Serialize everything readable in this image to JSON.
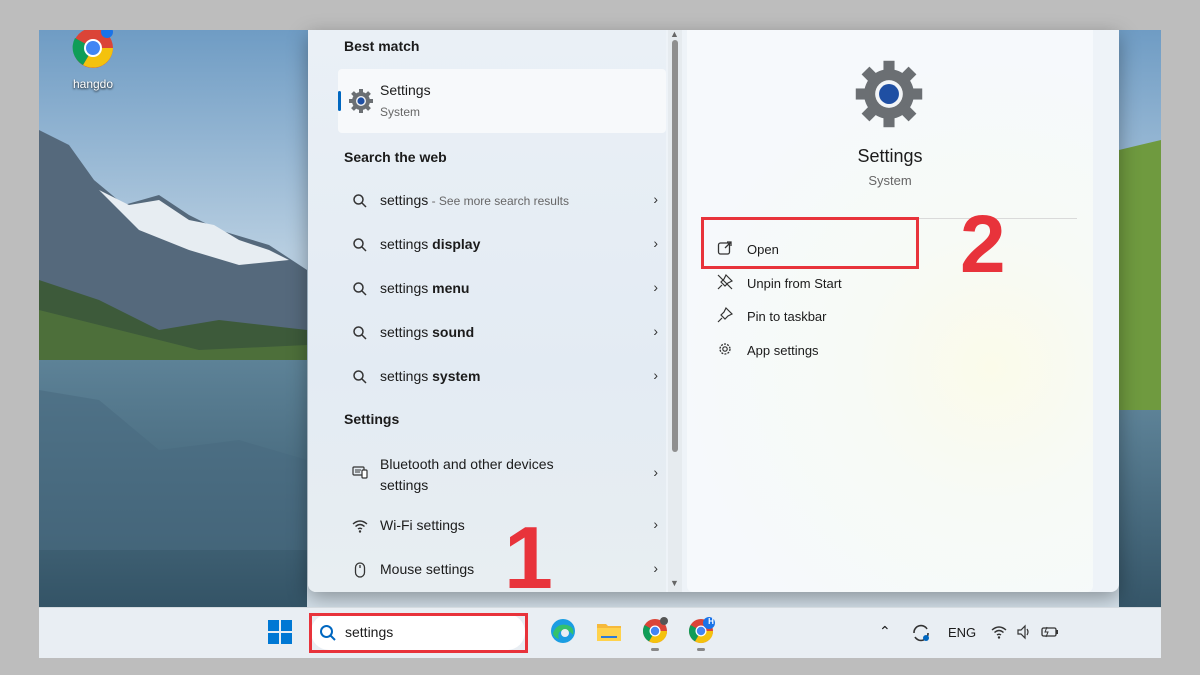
{
  "desktop": {
    "icon_label": "hangdo"
  },
  "flyout": {
    "best_match_heading": "Best match",
    "best_match": {
      "title": "Settings",
      "subtitle": "System"
    },
    "web_heading": "Search the web",
    "web_results": [
      {
        "query": "settings",
        "bold": "",
        "hint": " - See more search results"
      },
      {
        "query": "settings ",
        "bold": "display",
        "hint": ""
      },
      {
        "query": "settings ",
        "bold": "menu",
        "hint": ""
      },
      {
        "query": "settings ",
        "bold": "sound",
        "hint": ""
      },
      {
        "query": "settings ",
        "bold": "system",
        "hint": ""
      }
    ],
    "settings_heading": "Settings",
    "settings_results": [
      {
        "line1": "Bluetooth and other devices",
        "line2": "settings",
        "icon": "bluetooth-devices-icon"
      },
      {
        "line1": "Wi-Fi settings",
        "line2": "",
        "icon": "wifi-icon"
      },
      {
        "line1": "Mouse settings",
        "line2": "",
        "icon": "mouse-icon"
      }
    ]
  },
  "details": {
    "app_name": "Settings",
    "app_category": "System",
    "actions": [
      {
        "label": "Open",
        "icon": "open-external-icon"
      },
      {
        "label": "Unpin from Start",
        "icon": "unpin-icon"
      },
      {
        "label": "Pin to taskbar",
        "icon": "pin-icon"
      },
      {
        "label": "App settings",
        "icon": "gear-icon"
      }
    ]
  },
  "annotations": {
    "step1": "1",
    "step2": "2",
    "color": "#e8333b"
  },
  "taskbar": {
    "search_value": "settings",
    "language": "ENG",
    "avatar_badge": "H"
  },
  "colors": {
    "accent": "#0067c0",
    "gear": "#6b6f73"
  }
}
